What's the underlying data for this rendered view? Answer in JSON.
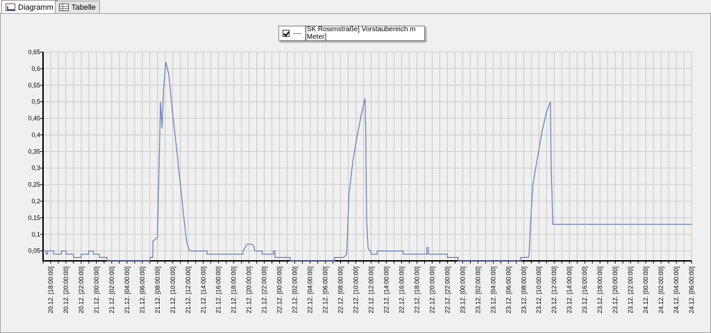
{
  "tabs": [
    {
      "label": "Diagramm",
      "icon": "chart-icon",
      "active": true
    },
    {
      "label": "Tabelle",
      "icon": "table-icon",
      "active": false
    }
  ],
  "legend": {
    "checked": true,
    "label": "[SK Rosenstraße] Vorstaubereich m [Meter]"
  },
  "colors": {
    "series": "#6b80b6",
    "grid": "#c8c8c8",
    "plot_bg": "#f0f0f0"
  },
  "chart_data": {
    "type": "line",
    "title": "",
    "xlabel": "",
    "ylabel": "",
    "ylim": [
      0.02,
      0.65
    ],
    "yticks": [
      "0,05",
      "0,1",
      "0,15",
      "0,2",
      "0,25",
      "0,3",
      "0,35",
      "0,4",
      "0,45",
      "0,5",
      "0,55",
      "0,6",
      "0,65"
    ],
    "ytick_values": [
      0.05,
      0.1,
      0.15,
      0.2,
      0.25,
      0.3,
      0.35,
      0.4,
      0.45,
      0.5,
      0.55,
      0.6,
      0.65
    ],
    "x_unit": "hours since 20.12. 17:00",
    "xlim": [
      0,
      85
    ],
    "xtick_labels": [
      "20.12. [18:00:00]",
      "20.12. [20:00:00]",
      "20.12. [22:00:00]",
      "21.12. [00:00:00]",
      "21.12. [02:00:00]",
      "21.12. [04:00:00]",
      "21.12. [06:00:00]",
      "21.12. [08:00:00]",
      "21.12. [10:00:00]",
      "21.12. [12:00:00]",
      "21.12. [14:00:00]",
      "21.12. [16:00:00]",
      "21.12. [18:00:00]",
      "21.12. [20:00:00]",
      "21.12. [22:00:00]",
      "22.12. [00:00:00]",
      "22.12. [02:00:00]",
      "22.12. [04:00:00]",
      "22.12. [06:00:00]",
      "22.12. [08:00:00]",
      "22.12. [10:00:00]",
      "22.12. [12:00:00]",
      "22.12. [14:00:00]",
      "22.12. [16:00:00]",
      "22.12. [18:00:00]",
      "22.12. [20:00:00]",
      "22.12. [22:00:00]",
      "23.12. [00:00:00]",
      "23.12. [02:00:00]",
      "23.12. [04:00:00]",
      "23.12. [06:00:00]",
      "23.12. [08:00:00]",
      "23.12. [10:00:00]",
      "23.12. [12:00:00]",
      "23.12. [14:00:00]",
      "23.12. [16:00:00]",
      "23.12. [18:00:00]",
      "23.12. [20:00:00]",
      "23.12. [22:00:00]",
      "24.12. [00:00:00]",
      "24.12. [02:00:00]",
      "24.12. [04:00:00]",
      "24.12. [06:00:00]"
    ],
    "xtick_positions": [
      1,
      3,
      5,
      7,
      9,
      11,
      13,
      15,
      17,
      19,
      21,
      23,
      25,
      27,
      29,
      31,
      33,
      35,
      37,
      39,
      41,
      43,
      45,
      47,
      49,
      51,
      53,
      55,
      57,
      59,
      61,
      63,
      65,
      67,
      69,
      71,
      73,
      75,
      77,
      79,
      81,
      83,
      85
    ],
    "grid": true,
    "legend_position": "top-center",
    "series": [
      {
        "name": "[SK Rosenstraße] Vorstaubereich m [Meter]",
        "points": [
          [
            0,
            0.05
          ],
          [
            0.4,
            0.05
          ],
          [
            0.4,
            0.04
          ],
          [
            0.6,
            0.04
          ],
          [
            0.6,
            0.05
          ],
          [
            1.4,
            0.05
          ],
          [
            1.4,
            0.04
          ],
          [
            2.4,
            0.04
          ],
          [
            2.4,
            0.05
          ],
          [
            3.0,
            0.05
          ],
          [
            3.0,
            0.04
          ],
          [
            4.0,
            0.04
          ],
          [
            4.0,
            0.03
          ],
          [
            5.0,
            0.03
          ],
          [
            5.0,
            0.04
          ],
          [
            6.0,
            0.04
          ],
          [
            6.0,
            0.05
          ],
          [
            6.6,
            0.05
          ],
          [
            6.6,
            0.04
          ],
          [
            7.4,
            0.04
          ],
          [
            7.4,
            0.03
          ],
          [
            8.4,
            0.03
          ],
          [
            8.4,
            0.02
          ],
          [
            14.0,
            0.02
          ],
          [
            14.0,
            0.03
          ],
          [
            14.4,
            0.03
          ],
          [
            14.4,
            0.08
          ],
          [
            15.0,
            0.09
          ],
          [
            15.2,
            0.3
          ],
          [
            15.4,
            0.5
          ],
          [
            15.6,
            0.42
          ],
          [
            15.8,
            0.54
          ],
          [
            16.1,
            0.62
          ],
          [
            16.5,
            0.58
          ],
          [
            17.0,
            0.46
          ],
          [
            17.5,
            0.36
          ],
          [
            18.0,
            0.25
          ],
          [
            18.5,
            0.14
          ],
          [
            18.8,
            0.08
          ],
          [
            19.2,
            0.05
          ],
          [
            21.5,
            0.05
          ],
          [
            21.5,
            0.04
          ],
          [
            26.2,
            0.04
          ],
          [
            26.2,
            0.05
          ],
          [
            26.5,
            0.06
          ],
          [
            26.7,
            0.07
          ],
          [
            27.4,
            0.07
          ],
          [
            27.7,
            0.06
          ],
          [
            27.7,
            0.05
          ],
          [
            28.7,
            0.05
          ],
          [
            28.7,
            0.04
          ],
          [
            30.2,
            0.04
          ],
          [
            30.2,
            0.05
          ],
          [
            30.4,
            0.05
          ],
          [
            30.4,
            0.03
          ],
          [
            32.4,
            0.03
          ],
          [
            32.4,
            0.02
          ],
          [
            38.2,
            0.02
          ],
          [
            38.2,
            0.03
          ],
          [
            39.4,
            0.03
          ],
          [
            39.8,
            0.04
          ],
          [
            40.1,
            0.22
          ],
          [
            40.6,
            0.32
          ],
          [
            41.2,
            0.4
          ],
          [
            41.7,
            0.46
          ],
          [
            42.2,
            0.51
          ],
          [
            42.3,
            0.4
          ],
          [
            42.4,
            0.15
          ],
          [
            42.6,
            0.06
          ],
          [
            42.8,
            0.05
          ],
          [
            43.0,
            0.05
          ],
          [
            43.0,
            0.04
          ],
          [
            43.8,
            0.04
          ],
          [
            43.8,
            0.05
          ],
          [
            47.2,
            0.05
          ],
          [
            47.2,
            0.04
          ],
          [
            50.3,
            0.04
          ],
          [
            50.3,
            0.06
          ],
          [
            50.5,
            0.06
          ],
          [
            50.5,
            0.04
          ],
          [
            53.0,
            0.04
          ],
          [
            53.0,
            0.03
          ],
          [
            54.4,
            0.03
          ],
          [
            54.4,
            0.02
          ],
          [
            62.6,
            0.02
          ],
          [
            62.6,
            0.03
          ],
          [
            63.6,
            0.03
          ],
          [
            63.7,
            0.04
          ],
          [
            63.9,
            0.13
          ],
          [
            64.2,
            0.25
          ],
          [
            64.8,
            0.33
          ],
          [
            65.4,
            0.41
          ],
          [
            66.0,
            0.47
          ],
          [
            66.5,
            0.5
          ],
          [
            66.6,
            0.3
          ],
          [
            66.7,
            0.23
          ],
          [
            66.8,
            0.13
          ],
          [
            85,
            0.13
          ]
        ]
      }
    ]
  }
}
